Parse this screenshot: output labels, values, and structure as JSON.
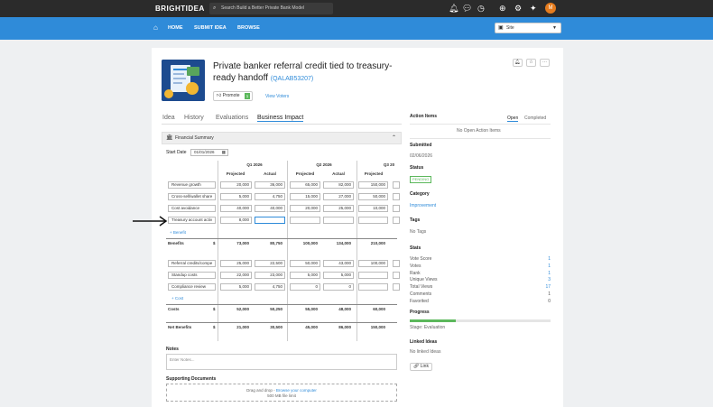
{
  "topbar": {
    "brand": "BRIGHTIDEA",
    "search_placeholder": "Search Build a Better Private Bank Model",
    "avatar": "M"
  },
  "nav": {
    "home": "HOME",
    "submit": "SUBMIT IDEA",
    "browse": "BROWSE",
    "site_select": "Site"
  },
  "idea": {
    "title": "Private banker referral credit tied to treasury-ready handoff",
    "code": "(QALAB53207)",
    "promote": "Promote",
    "promote_count": "1",
    "view_voters": "View Voters"
  },
  "tabs": [
    "Idea",
    "History",
    "Evaluations",
    "Business Impact"
  ],
  "financial": {
    "header": "Financial Summary",
    "start_date_label": "Start Date",
    "start_date": "01/01/2026",
    "quarters": [
      "Q1 2026",
      "Q2 2026",
      "Q3 20"
    ],
    "col_projected": "Projected",
    "col_actual": "Actual",
    "benefit_rows": [
      {
        "label": "Revenue growth",
        "v": [
          "20,000",
          "36,000",
          "65,000",
          "82,000",
          "150,000",
          ""
        ]
      },
      {
        "label": "Cross-sell/wallet share",
        "v": [
          "5,000",
          "4,750",
          "15,000",
          "27,000",
          "50,000",
          ""
        ]
      },
      {
        "label": "Cost avoidance",
        "v": [
          "40,000",
          "40,000",
          "20,000",
          "25,000",
          "10,000",
          ""
        ]
      },
      {
        "label": "Treasury account activ",
        "v": [
          "8,000",
          "",
          "",
          "",
          "",
          ""
        ]
      }
    ],
    "add_benefit": "+ Benefit",
    "benefits_total": {
      "label": "Benefits",
      "currency": "$",
      "v": [
        "73,000",
        "80,750",
        "100,000",
        "134,000",
        "210,000"
      ]
    },
    "cost_rows": [
      {
        "label": "Referral credits/compe",
        "v": [
          "25,000",
          "22,500",
          "50,000",
          "43,000",
          "100,000",
          ""
        ]
      },
      {
        "label": "Standup costs",
        "v": [
          "22,000",
          "23,000",
          "5,000",
          "5,000",
          "",
          ""
        ]
      },
      {
        "label": "Compliance review",
        "v": [
          "5,000",
          "4,750",
          "0",
          "0",
          "",
          ""
        ]
      }
    ],
    "add_cost": "+ Cost",
    "costs_total": {
      "label": "Costs",
      "currency": "$",
      "v": [
        "52,000",
        "50,250",
        "55,000",
        "48,000",
        "60,000"
      ]
    },
    "net_total": {
      "label": "Net Benefits",
      "currency": "$",
      "v": [
        "21,000",
        "30,500",
        "45,000",
        "86,000",
        "150,000"
      ]
    }
  },
  "notes": {
    "label": "Notes",
    "placeholder": "Enter Notes..."
  },
  "docs": {
    "label": "Supporting Documents",
    "drop": "Drag and drop -",
    "browse": "Browse your computer",
    "limit": "500 MB file limit"
  },
  "side": {
    "action_items": "Action Items",
    "open": "Open",
    "completed": "Completed",
    "no_open": "No Open Action Items",
    "submitted": "Submitted",
    "submitted_date": "02/06/2026",
    "status": "Status",
    "status_value": "PENDING",
    "category": "Category",
    "category_value": "Improvement",
    "tags": "Tags",
    "no_tags": "No Tags",
    "stats": "Stats",
    "stat_rows": [
      {
        "label": "Vote Score",
        "value": "1"
      },
      {
        "label": "Votes",
        "value": "1"
      },
      {
        "label": "Rank",
        "value": "1"
      },
      {
        "label": "Unique Views",
        "value": "3"
      },
      {
        "label": "Total Views",
        "value": "17"
      },
      {
        "label": "Comments",
        "value": "1"
      },
      {
        "label": "Favorited",
        "value": "0"
      }
    ],
    "progress": "Progress",
    "progress_fraction": 0.33,
    "stage": "Stage: Evaluation",
    "linked": "Linked Ideas",
    "no_linked": "No linked Ideas",
    "link_btn": "Link"
  },
  "colors": {
    "brand_blue": "#2f8bd9",
    "green": "#5cb85c",
    "orange": "#e57c1e"
  }
}
